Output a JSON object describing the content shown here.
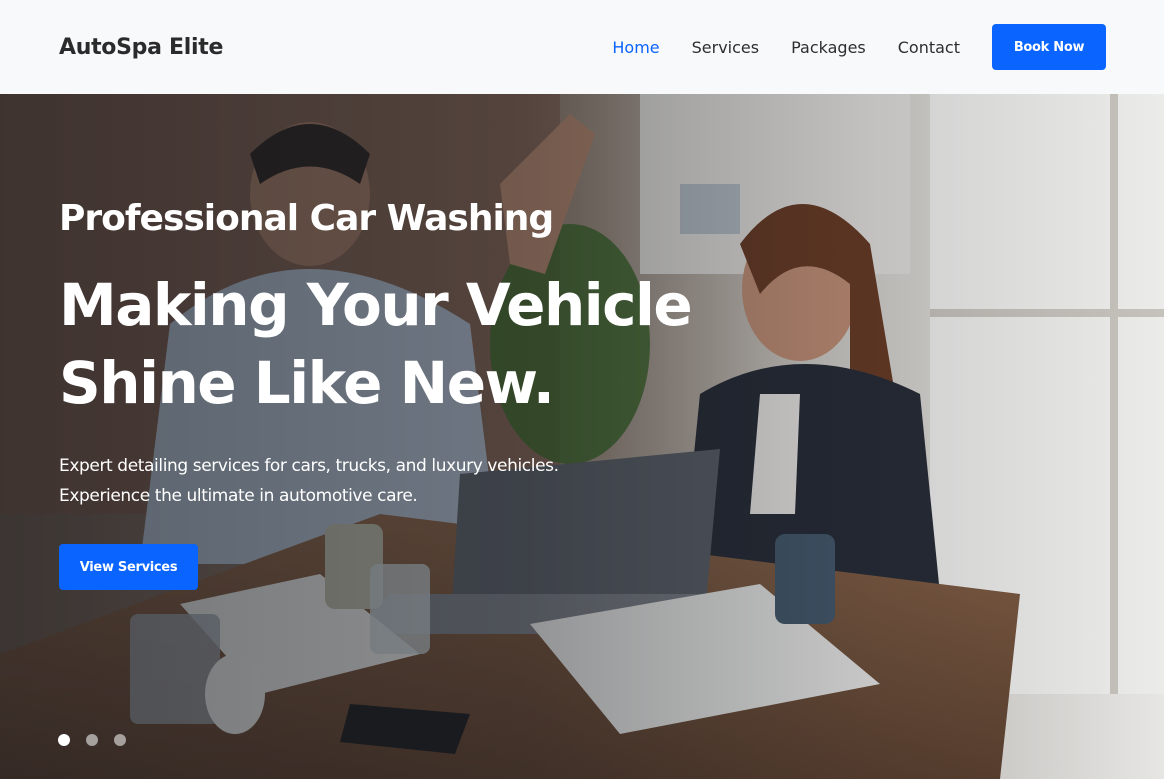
{
  "header": {
    "brand": "AutoSpa Elite",
    "nav": [
      {
        "label": "Home",
        "active": true
      },
      {
        "label": "Services",
        "active": false
      },
      {
        "label": "Packages",
        "active": false
      },
      {
        "label": "Contact",
        "active": false
      }
    ],
    "cta_label": "Book Now"
  },
  "hero": {
    "eyebrow": "Professional Car Washing",
    "headline_line1": "Making Your Vehicle",
    "headline_line2": "Shine Like New.",
    "subtext_line1": "Expert detailing services for cars, trucks, and luxury vehicles.",
    "subtext_line2": "Experience the ultimate in automotive care.",
    "cta_label": "View Services",
    "slides": 3,
    "active_slide": 1
  },
  "colors": {
    "accent": "#0a64ff",
    "header_bg": "#f8f9fa",
    "brand_text": "#2b2b2b"
  }
}
